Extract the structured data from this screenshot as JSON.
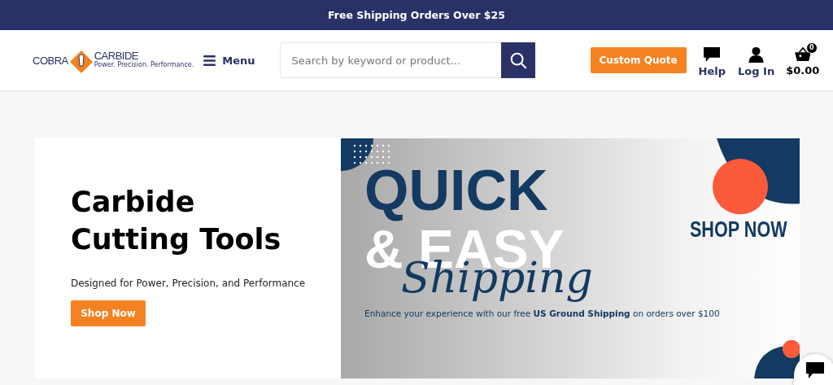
{
  "announcement": "Free Shipping Orders Over $25",
  "header": {
    "logo": {
      "left": "COBRA",
      "right": "CARBIDE",
      "tagline": "Power. Precision. Performance."
    },
    "menu": "Menu",
    "search": {
      "placeholder": "Search by keyword or product..."
    },
    "quote_button": "Custom Quote",
    "help": "Help",
    "login": "Log In",
    "cart": {
      "count": "0",
      "total": "$0.00"
    }
  },
  "hero": {
    "title_lines": [
      "Carbide",
      "Cutting Tools"
    ],
    "subtitle": "Designed for Power, Precision, and Performance",
    "button": "Shop Now"
  },
  "banner": {
    "line1": "QUICK",
    "line2": "& EASY",
    "script": "Shipping",
    "cta": "SHOP NOW",
    "note": "Enhance your experience with our free **US Ground Shipping** on orders over $100"
  }
}
